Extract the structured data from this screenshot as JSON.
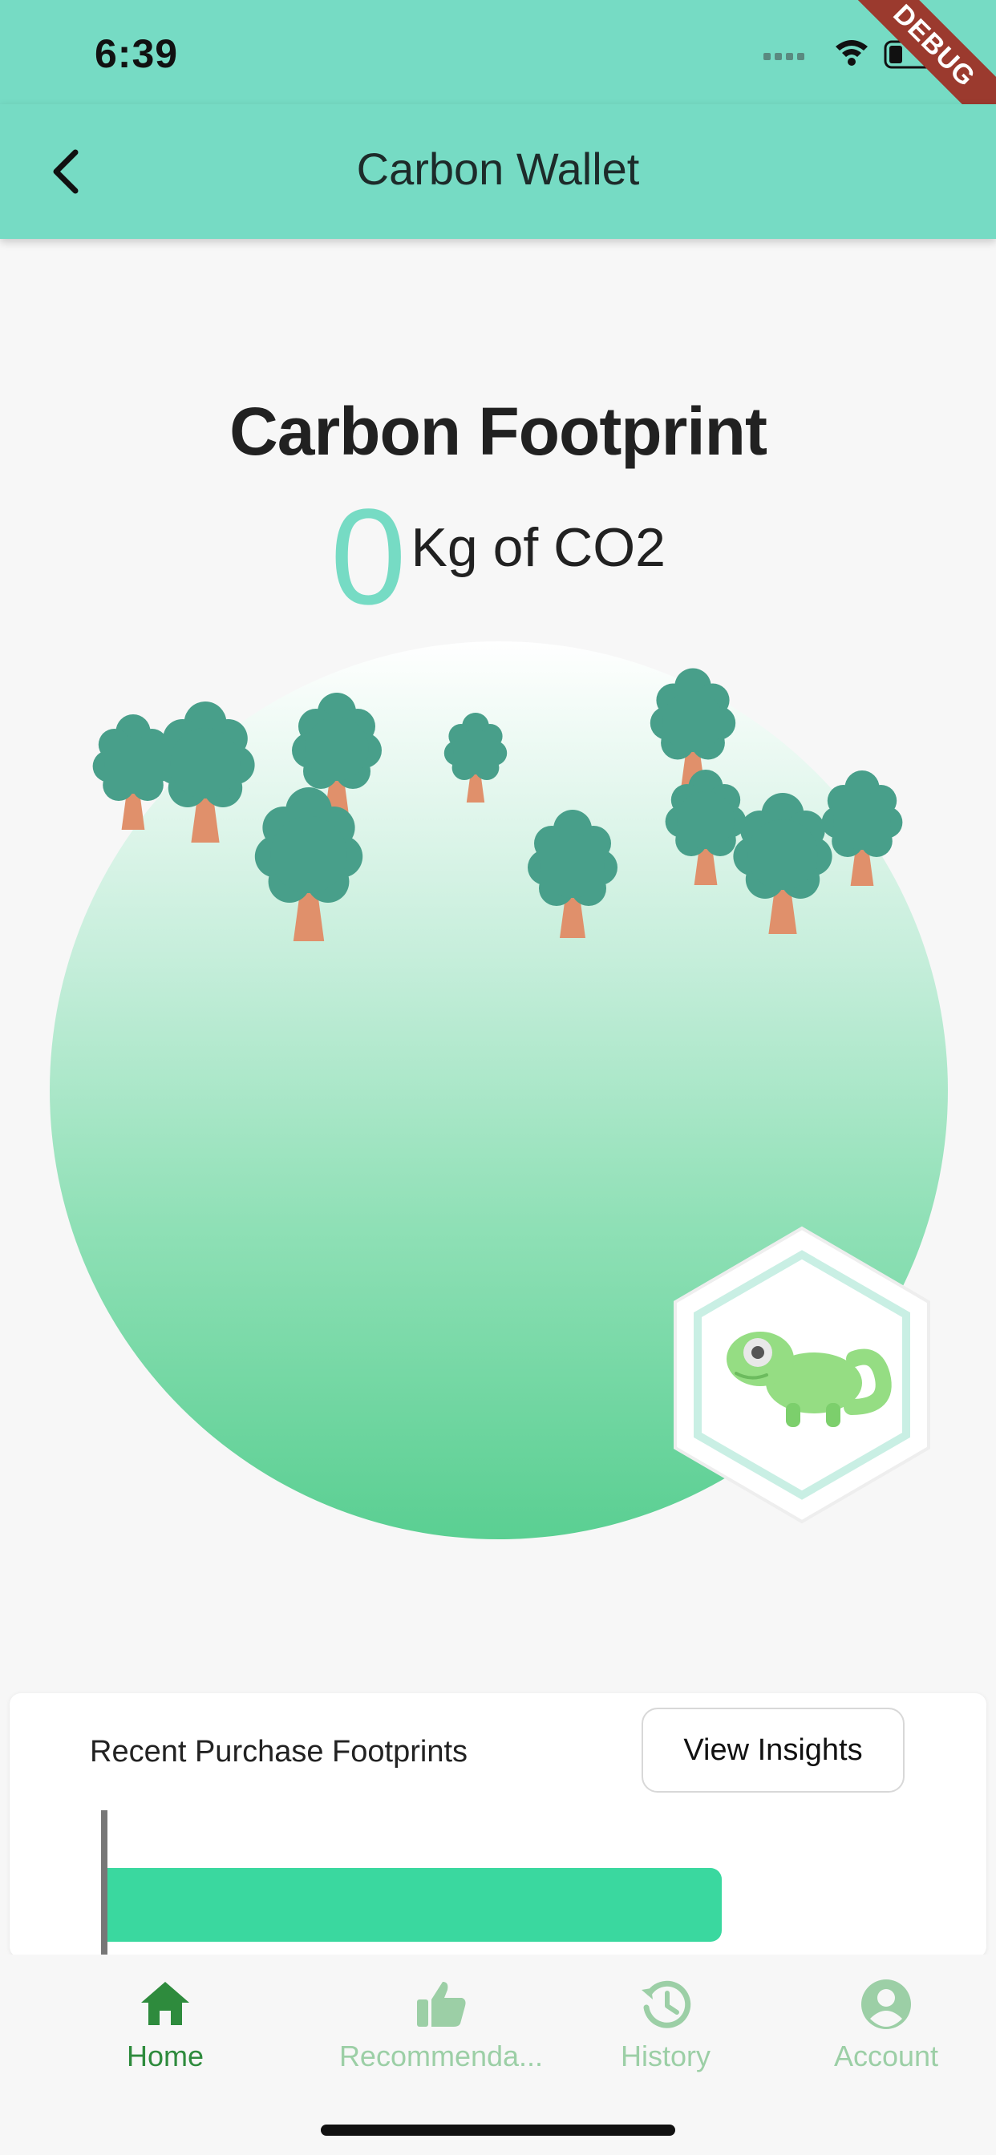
{
  "status_bar": {
    "time": "6:39",
    "debug_label": "DEBUG"
  },
  "app_bar": {
    "title": "Carbon Wallet",
    "back_icon": "chevron-left-icon"
  },
  "footprint": {
    "title": "Carbon Footprint",
    "value": "0",
    "unit": "Kg of CO2"
  },
  "colors": {
    "accent": "#76dbc4",
    "nav_active": "#2e8b3d",
    "nav_inactive": "#9ccfa6",
    "bar": "#3ad89f"
  },
  "recent": {
    "label": "Recent Purchase Footprints",
    "button": "View Insights"
  },
  "bottom_nav": {
    "items": [
      {
        "label": "Home",
        "icon": "home-icon",
        "active": true
      },
      {
        "label": "Recommenda...",
        "icon": "thumbs-up-icon",
        "active": false
      },
      {
        "label": "History",
        "icon": "history-icon",
        "active": false
      },
      {
        "label": "Account",
        "icon": "account-icon",
        "active": false
      }
    ]
  }
}
